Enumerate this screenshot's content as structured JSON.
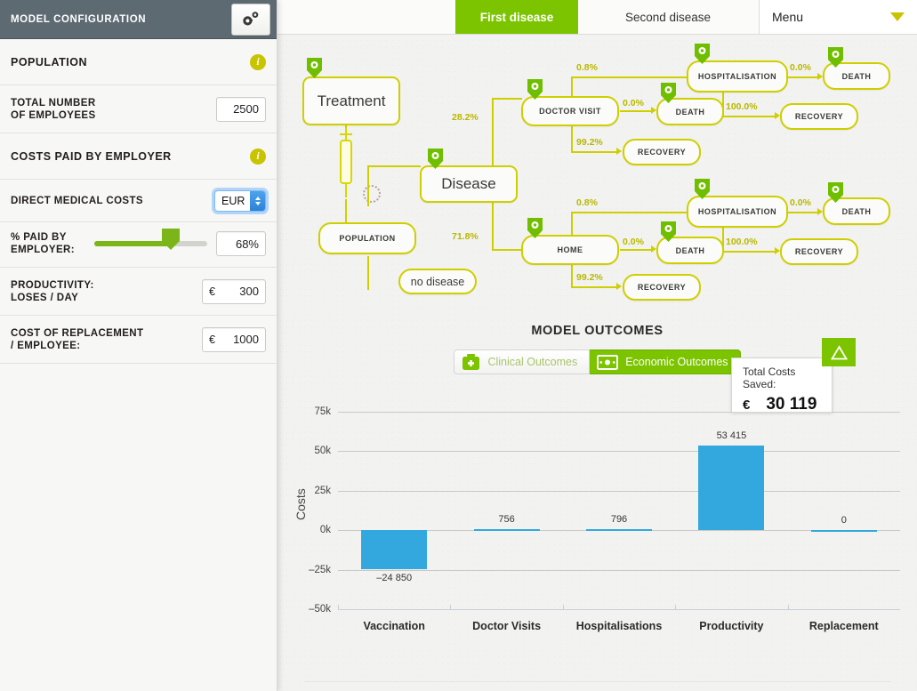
{
  "sidebar": {
    "header_title": "MODEL CONFIGURATION",
    "gear_icon": "gear-icon",
    "sections": {
      "population_label": "POPULATION",
      "costs_label": "COSTS PAID BY EMPLOYER",
      "info_icon": "info-icon"
    },
    "fields": {
      "total_employees_label_l1": "TOTAL NUMBER",
      "total_employees_label_l2": "OF EMPLOYEES",
      "total_employees_value": "2500",
      "direct_medical_label": "DIRECT MEDICAL COSTS",
      "currency_value": "EUR",
      "pct_paid_label_l1": "% PAID BY",
      "pct_paid_label_l2": "EMPLOYER:",
      "pct_paid_value": "68%",
      "pct_paid_slider": 68,
      "productivity_label_l1": "PRODUCTIVITY:",
      "productivity_label_l2": "LOSES / DAY",
      "productivity_symbol": "€",
      "productivity_value": "300",
      "replacement_label_l1": "COST OF REPLACEMENT",
      "replacement_label_l2": "/ EMPLOYEE:",
      "replacement_symbol": "€",
      "replacement_value": "1000"
    }
  },
  "tabs": {
    "first": "First disease",
    "second": "Second disease",
    "menu_label": "Menu",
    "caret_icon": "chevron-down-icon"
  },
  "diagram": {
    "nodes": {
      "treatment": "Treatment",
      "population": "POPULATION",
      "no_disease": "no disease",
      "disease": "Disease",
      "doctor_visit": "DOCTOR VISIT",
      "home": "HOME",
      "hospitalisation_top": "HOSPITALISATION",
      "hospitalisation_bottom": "HOSPITALISATION",
      "death_dv": "DEATH",
      "recovery_dv": "RECOVERY",
      "death_hosp_top": "DEATH",
      "recovery_hosp_top": "RECOVERY",
      "death_home": "DEATH",
      "recovery_home": "RECOVERY",
      "death_hosp_bottom": "DEATH",
      "recovery_hosp_bottom": "RECOVERY"
    },
    "percents": {
      "disease_to_doctor": "28.2%",
      "disease_to_home": "71.8%",
      "dv_to_hosp": "0.8%",
      "dv_to_death": "0.0%",
      "dv_to_recovery": "99.2%",
      "hosp_top_to_death": "0.0%",
      "hosp_top_to_recovery": "100.0%",
      "home_to_hosp": "0.8%",
      "home_to_death": "0.0%",
      "home_to_recovery": "99.2%",
      "hosp_bottom_to_death": "0.0%",
      "hosp_bottom_to_recovery": "100.0%"
    },
    "icons": {
      "pin": "gear-pin-icon",
      "syringe": "syringe-icon",
      "circle": "dotted-circle-icon"
    }
  },
  "outcomes": {
    "title": "MODEL OUTCOMES",
    "clinical_label": "Clinical Outcomes",
    "economic_label": "Economic Outcomes",
    "clinical_icon": "medical-bag-icon",
    "economic_icon": "banknote-icon",
    "callout": {
      "title": "Total Costs Saved:",
      "symbol": "€",
      "value": "30 119",
      "badge_icon": "triangle-icon"
    }
  },
  "chart_data": {
    "type": "bar",
    "title": "MODEL OUTCOMES",
    "xlabel": "",
    "ylabel": "Costs",
    "categories": [
      "Vaccination",
      "Doctor Visits",
      "Hospitalisations",
      "Productivity",
      "Replacement"
    ],
    "values": [
      -24850,
      756,
      796,
      53415,
      0
    ],
    "value_labels": [
      "–24 850",
      "756",
      "796",
      "53 415",
      "0"
    ],
    "ylim": [
      -50000,
      75000
    ],
    "yticks": [
      75000,
      50000,
      25000,
      0,
      -25000,
      -50000
    ],
    "ytick_labels": [
      "75k",
      "50k",
      "25k",
      "0k",
      "–25k",
      "–50k"
    ],
    "grid": true,
    "legend": "none",
    "bar_color": "#33a8de"
  },
  "colors": {
    "accent_green": "#7cc400",
    "node_yellow": "#cfcf00",
    "bar_blue": "#33a8de",
    "header_gray": "#5e6a72"
  }
}
